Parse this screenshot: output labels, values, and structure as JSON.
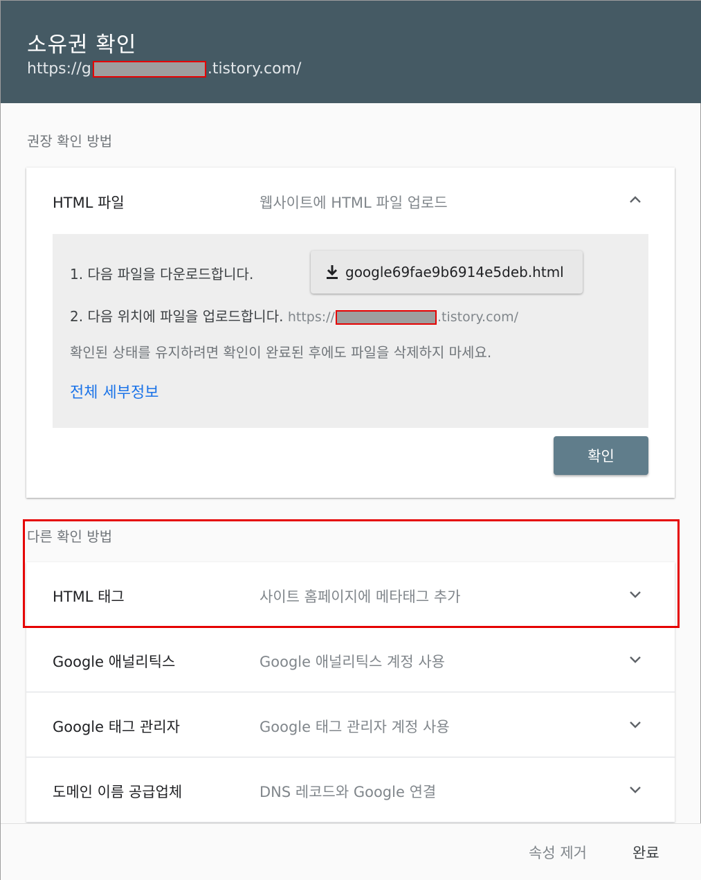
{
  "header": {
    "title": "소유권 확인",
    "url_prefix": "https://g",
    "url_suffix": ".tistory.com/"
  },
  "recommended": {
    "section_label": "권장 확인 방법",
    "method_name": "HTML 파일",
    "method_desc": "웹사이트에 HTML 파일 업로드",
    "step1": "1. 다음 파일을 다운로드합니다.",
    "download_file": "google69fae9b6914e5deb.html",
    "step2": "2. 다음 위치에 파일을 업로드합니다.",
    "step2_url_prefix": "https://",
    "step2_url_suffix": ".tistory.com/",
    "note": "확인된 상태를 유지하려면 확인이 완료된 후에도 파일을 삭제하지 마세요.",
    "details_link": "전체 세부정보",
    "verify_label": "확인"
  },
  "other": {
    "section_label": "다른 확인 방법",
    "methods": [
      {
        "name": "HTML 태그",
        "desc": "사이트 홈페이지에 메타태그 추가"
      },
      {
        "name": "Google 애널리틱스",
        "desc": "Google 애널리틱스 계정 사용"
      },
      {
        "name": "Google 태그 관리자",
        "desc": "Google 태그 관리자 계정 사용"
      },
      {
        "name": "도메인 이름 공급업체",
        "desc": "DNS 레코드와 Google 연결"
      }
    ]
  },
  "footer": {
    "remove_label": "속성 제거",
    "done_label": "완료"
  },
  "colors": {
    "header_bg": "#455a64",
    "verify_button": "#607d8b",
    "link": "#1a73e8",
    "highlight": "#e50000"
  },
  "icons": {
    "expand": "chevron-down-icon",
    "collapse": "chevron-up-icon",
    "download": "download-icon"
  }
}
